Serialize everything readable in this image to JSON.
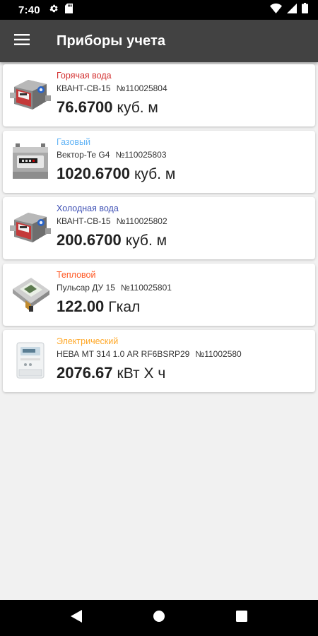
{
  "status_bar": {
    "time": "7:40"
  },
  "app_bar": {
    "title": "Приборы учета"
  },
  "meters": [
    {
      "type": "Горячая вода",
      "type_color": "#d32f2f",
      "model": "КВАНТ-СВ-15",
      "number": "№110025804",
      "value": "76.6700",
      "unit": "куб. м",
      "icon": "hot-water-meter-icon"
    },
    {
      "type": "Газовый",
      "type_color": "#64b5f6",
      "model": "Вектор-Те G4",
      "number": "№110025803",
      "value": "1020.6700",
      "unit": "куб. м",
      "icon": "gas-meter-icon"
    },
    {
      "type": "Холодная вода",
      "type_color": "#3f51b5",
      "model": "КВАНТ-СВ-15",
      "number": "№110025802",
      "value": "200.6700",
      "unit": "куб. м",
      "icon": "cold-water-meter-icon"
    },
    {
      "type": "Тепловой",
      "type_color": "#ff5722",
      "model": "Пульсар ДУ 15",
      "number": "№110025801",
      "value": "122.00",
      "unit": "Гкал",
      "icon": "heat-meter-icon"
    },
    {
      "type": "Электрический",
      "type_color": "#ffa726",
      "model": "НЕВА МТ 314 1.0 AR RF6BSRP29",
      "number": "№11002580",
      "value": "2076.67",
      "unit": "кВт Х ч",
      "icon": "electric-meter-icon"
    }
  ]
}
